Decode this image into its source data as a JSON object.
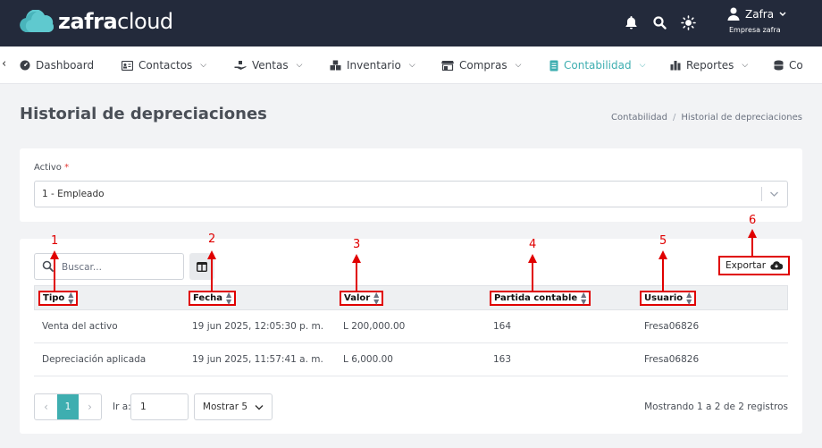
{
  "brand": {
    "name_bold": "zafra",
    "name_light": "cloud"
  },
  "header": {
    "user_name": "Zafra",
    "company": "Empresa zafra"
  },
  "nav": {
    "items": [
      {
        "label": "Dashboard",
        "icon": "dashboard-icon",
        "dropdown": false
      },
      {
        "label": "Contactos",
        "icon": "contacts-card-icon",
        "dropdown": true
      },
      {
        "label": "Ventas",
        "icon": "sales-hand-icon",
        "dropdown": true
      },
      {
        "label": "Inventario",
        "icon": "boxes-icon",
        "dropdown": true
      },
      {
        "label": "Compras",
        "icon": "store-icon",
        "dropdown": true
      },
      {
        "label": "Contabilidad",
        "icon": "ledger-icon",
        "dropdown": true,
        "active": true
      },
      {
        "label": "Reportes",
        "icon": "bar-chart-icon",
        "dropdown": true
      },
      {
        "label": "Co",
        "icon": "database-icon",
        "dropdown": false
      }
    ]
  },
  "page": {
    "title": "Historial de depreciaciones",
    "breadcrumb": [
      "Contabilidad",
      "Historial de depreciaciones"
    ]
  },
  "filter": {
    "label": "Activo",
    "required_mark": "*",
    "selected": "1 - Empleado"
  },
  "toolbar": {
    "search_placeholder": "Buscar...",
    "export_label": "Exportar"
  },
  "table": {
    "columns": [
      "Tipo",
      "Fecha",
      "Valor",
      "Partida contable",
      "Usuario"
    ],
    "rows": [
      [
        "Venta del activo",
        "19 jun 2025, 12:05:30 p. m.",
        "L 200,000.00",
        "164",
        "Fresa06826"
      ],
      [
        "Depreciación aplicada",
        "19 jun 2025, 11:57:41 a. m.",
        "L 6,000.00",
        "163",
        "Fresa06826"
      ]
    ]
  },
  "pagination": {
    "current_page": "1",
    "goto_label": "Ir a:",
    "goto_value": "1",
    "page_size_label": "Mostrar 5",
    "records_text": "Mostrando 1 a 2 de 2 registros"
  },
  "annotations": [
    "1",
    "2",
    "3",
    "4",
    "5",
    "6"
  ],
  "colors": {
    "topbar": "#232a3b",
    "accent": "#3eaeb0",
    "annotation": "#e00000"
  }
}
